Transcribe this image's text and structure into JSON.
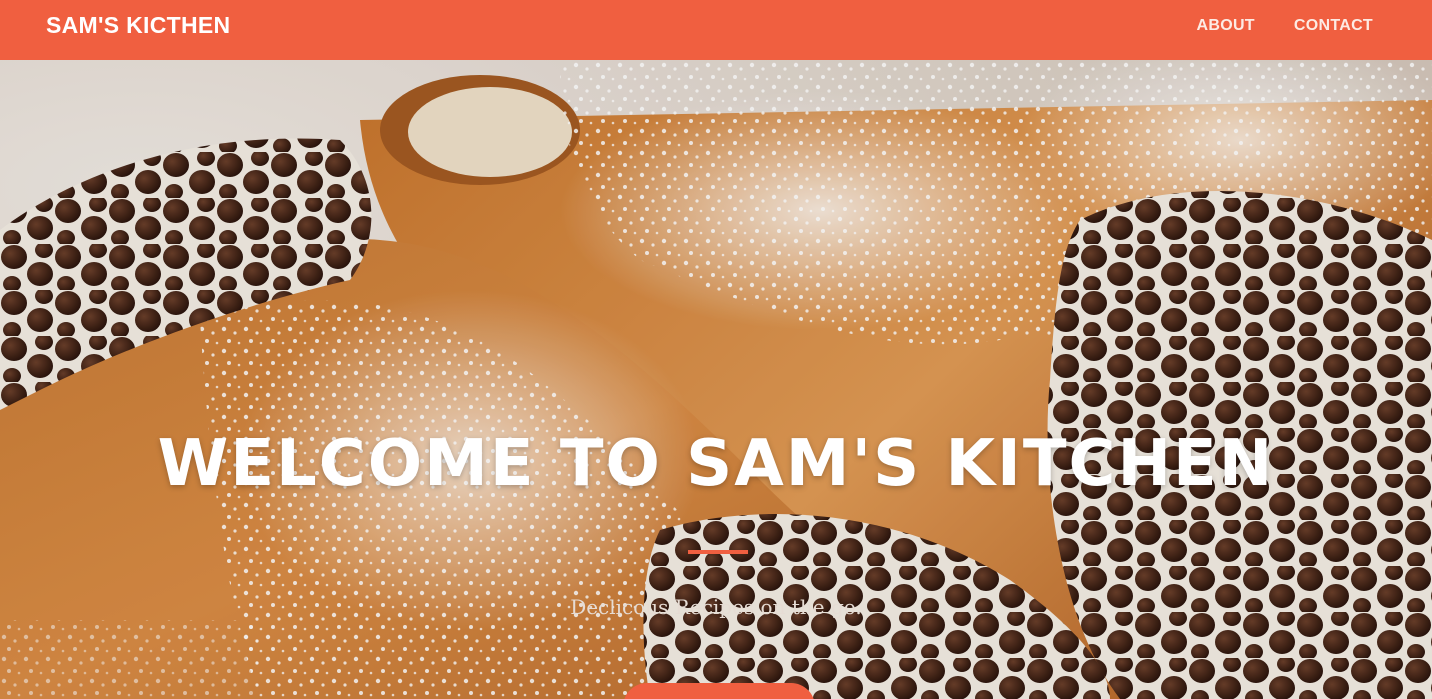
{
  "navbar": {
    "brand": "SAM'S KICTHEN",
    "links": [
      {
        "label": "ABOUT"
      },
      {
        "label": "CONTACT"
      }
    ],
    "background_color": "#f05f40"
  },
  "hero": {
    "image_subject": "cannoli dusted with powdered sugar and filled with cream and chocolate chips",
    "title": "WELCOME TO SAM'S KITCHEN",
    "subtitle": "Declicous Recipes on the go.",
    "cta_label": "",
    "accent_color": "#f05f40"
  }
}
